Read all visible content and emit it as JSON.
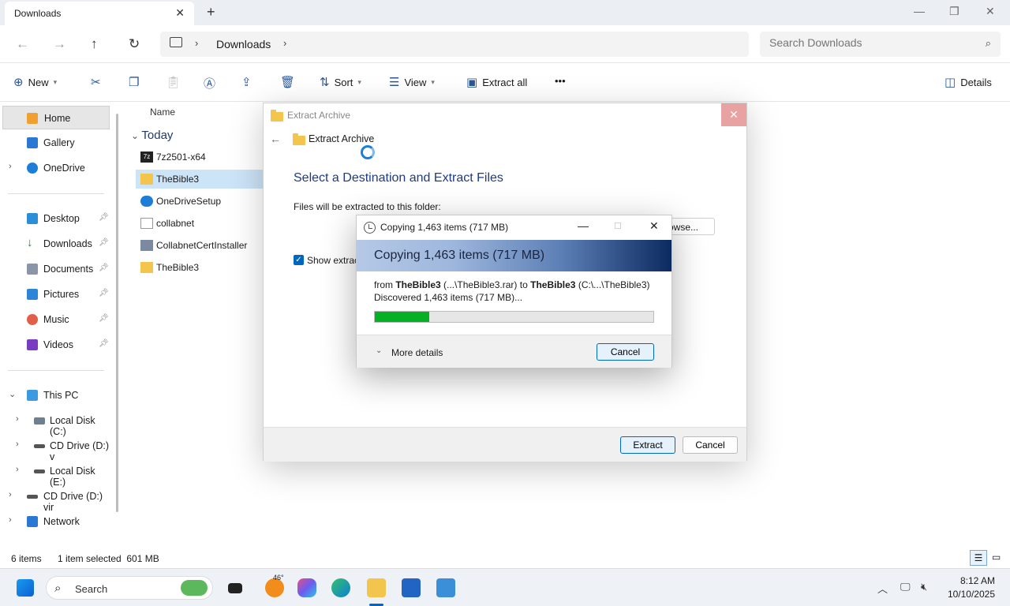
{
  "tabbar": {
    "tab_title": "Downloads",
    "close_glyph": "✕",
    "new_tab_glyph": "+"
  },
  "window_controls": {
    "minimize": "—",
    "maximize": "❐",
    "close": "✕"
  },
  "address": {
    "back_glyph": "←",
    "forward_glyph": "→",
    "up_glyph": "↑",
    "refresh_glyph": "↻",
    "location": "Downloads",
    "search_placeholder": "Search Downloads",
    "search_icon": "search-icon"
  },
  "commands": {
    "new": "New",
    "sort": "Sort",
    "view": "View",
    "extract_all": "Extract all",
    "more": "•••",
    "details": "Details"
  },
  "sidebar": {
    "home": "Home",
    "gallery": "Gallery",
    "onedrive": "OneDrive",
    "desktop": "Desktop",
    "downloads": "Downloads",
    "documents": "Documents",
    "pictures": "Pictures",
    "music": "Music",
    "videos": "Videos",
    "this_pc": "This PC",
    "local_c": "Local Disk (C:)",
    "cd_d": "CD Drive (D:) v",
    "local_e": "Local Disk (E:)",
    "cd_d2": "CD Drive (D:) vir",
    "network": "Network"
  },
  "filelist": {
    "column_name": "Name",
    "group": "Today",
    "files": [
      "7z2501-x64",
      "TheBible3",
      "OneDriveSetup",
      "collabnet",
      "CollabnetCertInstaller",
      "TheBible3"
    ]
  },
  "status": {
    "items": "6 items",
    "selected": "1 item selected  601 MB"
  },
  "extract_dialog": {
    "title": "Extract Archive",
    "header": "Extract Archive",
    "heading": "Select a Destination and Extract Files",
    "files_label": "Files will be extracted to this folder:",
    "browse": "owse...",
    "show_label": "Show extract",
    "extract_btn": "Extract",
    "cancel_btn": "Cancel"
  },
  "copy_dialog": {
    "title": "Copying 1,463 items (717 MB)",
    "banner": "Copying 1,463 items (717 MB)",
    "from_word": "from",
    "from_name": "TheBible3",
    "from_path": "(...\\TheBible3.rar)",
    "to_word": "to",
    "to_name": "TheBible3",
    "to_path": "(C:\\...\\TheBible3)",
    "discovered": "Discovered 1,463 items (717 MB)...",
    "progress": 0.195,
    "more_details": "More details",
    "cancel": "Cancel"
  },
  "taskbar": {
    "search": "Search",
    "weather": "46°",
    "time": "8:12 AM",
    "date": "10/10/2025"
  },
  "colors": {
    "accent": "#0067c0",
    "progress": "#06b025",
    "folder": "#f3c54c"
  }
}
